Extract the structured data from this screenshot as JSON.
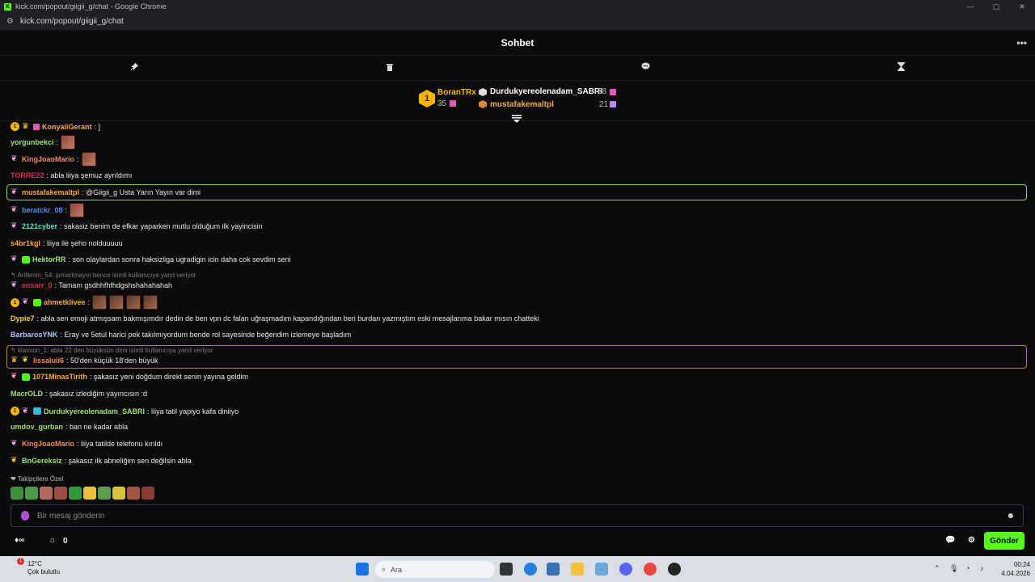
{
  "window": {
    "title": "kick.com/popout/giigii_g/chat - Google Chrome",
    "url": "kick.com/popout/giigii_g/chat",
    "favicon_letter": "K",
    "controls": [
      "—",
      "▢",
      "✕"
    ]
  },
  "chat": {
    "title": "Sohbet",
    "more_label": "•••"
  },
  "leaderboard": {
    "top": {
      "rank": "1",
      "name": "BoranTRx",
      "count": "35"
    },
    "second": {
      "name": "Durdukyereolenadam_SABRI",
      "count": "28"
    },
    "third": {
      "name": "mustafakemaltpl",
      "count": "21"
    }
  },
  "messages": [
    {
      "user": "KonyaliGerant",
      "text": ": ]"
    },
    {
      "user": "yorgunbekci",
      "text": ":"
    },
    {
      "user": "KingJoaoMario",
      "text": ":"
    },
    {
      "user": "TORRE22",
      "text": ": abla liiya şemuz ayrıldımı"
    },
    {
      "user": "mustafakemaltpl",
      "text": ": @Giigii_g Usta Yarın Yayın var dimi"
    },
    {
      "user": "beratckr_08",
      "text": ":"
    },
    {
      "user": "2121cyber",
      "text": ": sakasiz benim de efkar yaparken mutlu olduğum ilk yayincisin"
    },
    {
      "user": "s4br1kgl",
      "text": ": liiya ile şeho nolduuuuu"
    },
    {
      "user": "HektorRR",
      "text": ": son olaylardan sonra haksizliga ugradigin icin daha cok sevdim seni"
    },
    {
      "user": "ensarr_0",
      "text": ": Tamam gsdhhfhfhdgshshahahahah"
    },
    {
      "user": "ahmetklivee",
      "text": ":"
    },
    {
      "user": "Dypie7",
      "text": ": abla sen emoji atmışsam bakmışımdır dedin de ben vpn dc falan uğraşmadım kapandığından beri burdan yazmıştım eski mesajlarıma bakar mısın chatteki"
    },
    {
      "user": "BarbarosYNK",
      "text": ": Eray ve 5etul harici pek takılmıyordum bende rol sayesinde beğendim izlemeye başladım"
    },
    {
      "user": "lissaluii6",
      "text": ": 50'den küçük 18'den büyük"
    },
    {
      "user": "1071MinasTirith",
      "text": ": şakasız yeni doğdum direkt senin yayına geldim"
    },
    {
      "user": "MacrOLD",
      "text": ": şakasız izlediğim yayıncısın :d"
    },
    {
      "user": "Durdukyereolenadam_SABRI",
      "text": ": liiya tatil yapiyo kafa diniiyo"
    },
    {
      "user": "umdov_gurban",
      "text": ": ban ne kadar abla"
    },
    {
      "user": "KingJoaoMario",
      "text": ": liiya tatilde telefonu kırıldı"
    },
    {
      "user": "BnGereksiz",
      "text": ": şakasız ilk abneliğim sen değilsin abla"
    }
  ],
  "replies": {
    "r1": "Arifemin_54: şımartmayın bence isimli kullanıcıya yanıt veriyor",
    "r2": "klaxxon_1: abla 22 den büyüksün dimi isimli kullanıcıya yanıt veriyor"
  },
  "followers_only_label": "❤ Takipçilere Özel",
  "input": {
    "placeholder": "Bir mesaj gönderin"
  },
  "footer": {
    "gift_count": "0",
    "send_label": "Gönder"
  },
  "taskbar": {
    "temp": "12°C",
    "weather": "Çok bulutlu",
    "weather_badge": "1",
    "search_label": "Ara",
    "time": "00:24",
    "date": "4.04.2026"
  },
  "colors": {
    "accent": "#53fc18",
    "gold": "#f5b400",
    "mention_border": "#8bd15a"
  }
}
